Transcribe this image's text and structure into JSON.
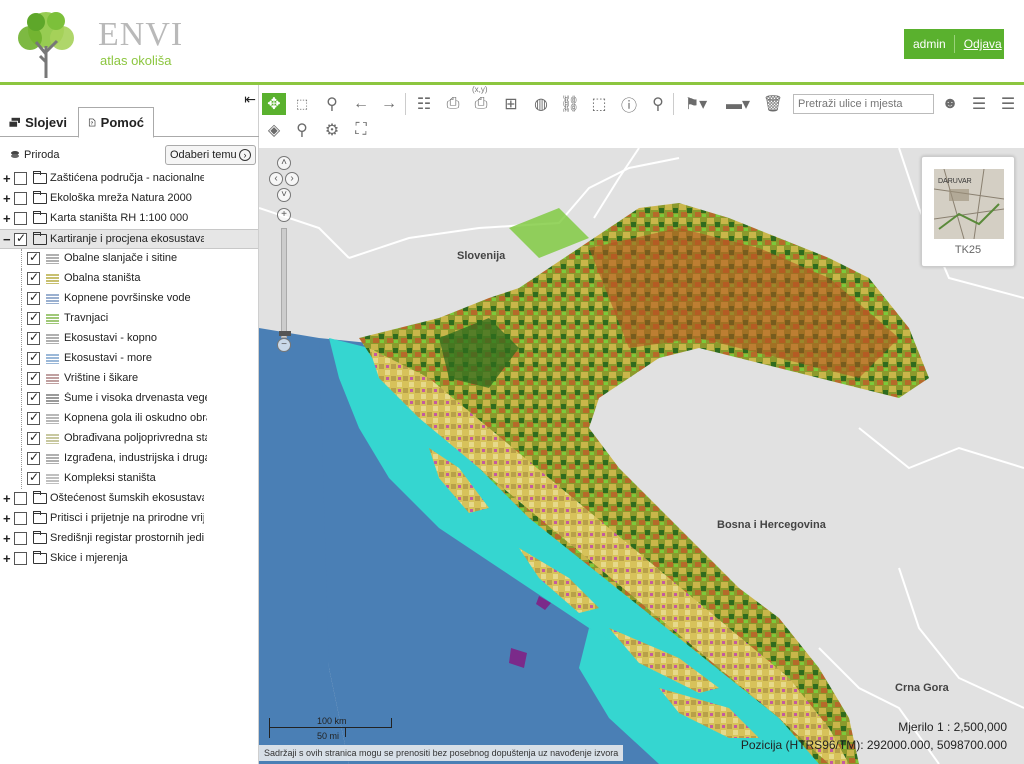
{
  "header": {
    "logo_title": "ENVI",
    "logo_subtitle": "atlas okoliša",
    "user": "admin",
    "logout": "Odjava",
    "accent_color": "#8cc63f",
    "button_color": "#5ab12e"
  },
  "left_panel": {
    "tabs": [
      {
        "label": "Slojevi",
        "icon": "layers-icon"
      },
      {
        "label": "Pomoć",
        "icon": "help-icon"
      }
    ],
    "theme_label": "Priroda",
    "theme_button": "Odaberi temu",
    "tree": [
      {
        "label": "Zaštićena područja - nacionalne",
        "checked": false,
        "expanded": false
      },
      {
        "label": "Ekološka mreža Natura 2000",
        "checked": false,
        "expanded": false
      },
      {
        "label": "Karta staništa RH 1:100 000",
        "checked": false,
        "expanded": false
      },
      {
        "label": "Kartiranje i procjena ekosustava",
        "checked": true,
        "expanded": true,
        "selected": true,
        "children": [
          {
            "label": "Obalne slanjače i sitine",
            "checked": true
          },
          {
            "label": "Obalna staništa",
            "checked": true
          },
          {
            "label": "Kopnene površinske vode",
            "checked": true
          },
          {
            "label": "Travnjaci",
            "checked": true
          },
          {
            "label": "Ekosustavi - kopno",
            "checked": true
          },
          {
            "label": "Ekosustavi - more",
            "checked": true
          },
          {
            "label": "Vrištine i šikare",
            "checked": true
          },
          {
            "label": "Šume i visoka drvenasta vege",
            "checked": true
          },
          {
            "label": "Kopnena gola ili oskudno obra",
            "checked": true
          },
          {
            "label": "Obrađivana poljoprivredna sta",
            "checked": true
          },
          {
            "label": "Izgrađena, industrijska i druga",
            "checked": true
          },
          {
            "label": "Kompleksi staništa",
            "checked": true
          }
        ]
      },
      {
        "label": "Oštećenost šumskih ekosustava",
        "checked": false,
        "expanded": false
      },
      {
        "label": "Pritisci i prijetnje na prirodne vrije",
        "checked": false,
        "expanded": false
      },
      {
        "label": "Središnji registar prostornih jedin",
        "checked": false,
        "expanded": false
      },
      {
        "label": "Skice i mjerenja",
        "checked": false,
        "expanded": false
      }
    ]
  },
  "toolbar": {
    "search_placeholder": "Pretraži ulice i mjesta",
    "xy_label": "(x,y)",
    "tools": [
      "pan-icon",
      "zoom-box-icon",
      "identify-icon",
      "back-icon",
      "forward-icon",
      "compare-icon",
      "print-icon",
      "print-xy-icon",
      "hierarchy-icon",
      "globe-icon",
      "link-icon",
      "select-info-icon",
      "info-icon",
      "search-icon",
      "marker-icon",
      "measure-icon",
      "clear-icon",
      "user-search-icon",
      "database-icon",
      "database-add-icon",
      "layers-icon",
      "zoom-layer-icon",
      "settings-icon",
      "fullscreen-icon"
    ]
  },
  "map": {
    "labels": {
      "slovenia": "Slovenija",
      "bih": "Bosna i Hercegovina",
      "cg": "Crna Gora"
    },
    "minimap_label": "TK25",
    "minimap_text": "DARUVAR",
    "scale_km": "100 km",
    "scale_mi": "50 mi",
    "scale_text": "Mjerilo 1 : 2,500,000",
    "coord_readout": "Pozicija (HTRS96/TM):  292000.000, 5098700.000",
    "disclaimer": "Sadržaji s ovih stranica mogu se prenositi bez posebnog dopuštenja uz navođenje izvora",
    "colors": {
      "background": "#e1e1e1",
      "sea_deep": "#4a7fb5",
      "sea_shallow": "#35d6d0",
      "forest": "#2f6b1e",
      "agriculture": "#c9b64a",
      "urban": "#c0502a"
    }
  }
}
